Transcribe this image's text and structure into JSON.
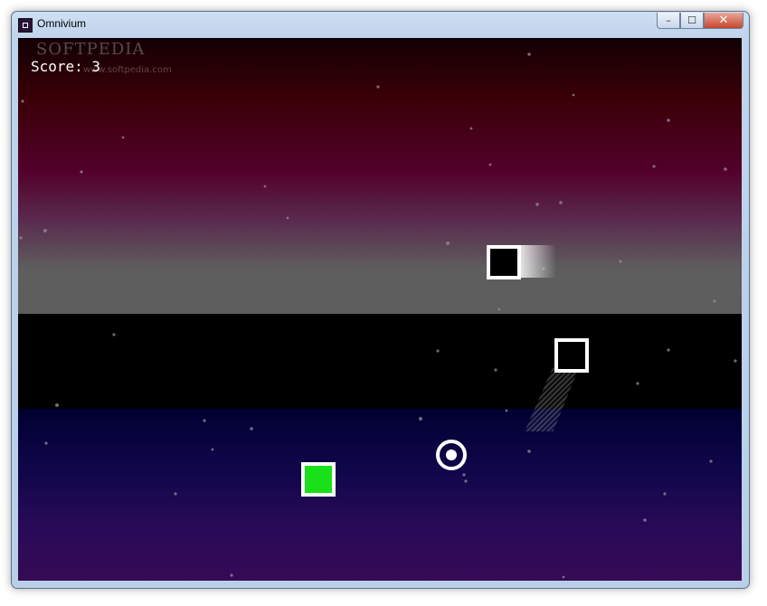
{
  "window": {
    "title": "Omnivium",
    "icon": "omnivium-app-icon",
    "controls": {
      "minimize": "–",
      "maximize": "☐",
      "close": "✕"
    }
  },
  "game": {
    "hud": {
      "score_text": "Score: 3"
    },
    "watermark": {
      "brand": "SOFTPEDIA",
      "url": "www.softpedia.com"
    },
    "colors": {
      "player_fill": "#19e019",
      "enemy_fill": "#000000",
      "outline": "#ffffff"
    }
  }
}
